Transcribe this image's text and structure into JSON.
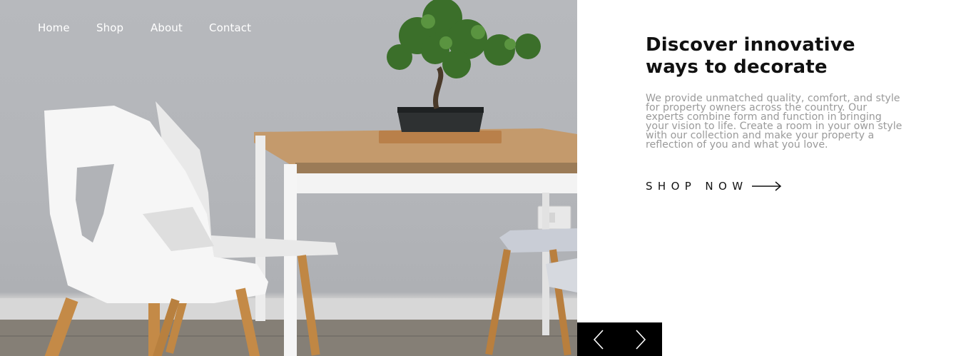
{
  "nav": {
    "items": [
      {
        "label": "Home"
      },
      {
        "label": "Shop"
      },
      {
        "label": "About"
      },
      {
        "label": "Contact"
      }
    ]
  },
  "hero": {
    "title_line1": "Discover innovative",
    "title_line2": "ways to decorate",
    "description_lines": [
      "We provide unmatched quality, comfort, and style",
      "for property owners across the country. Our",
      "experts combine form and function in bringing",
      "your vision to life. Create a room in your own style",
      "with our collection and make your property a",
      "reflection of you and what you love."
    ],
    "cta_label": "SHOP NOW"
  },
  "icons": {
    "cta": "arrow-right-icon",
    "prev": "chevron-left-icon",
    "next": "chevron-right-icon"
  },
  "colors": {
    "title": "#111111",
    "description": "#9a9a9a",
    "slider_bg": "#000000",
    "nav_text": "#ffffff"
  }
}
